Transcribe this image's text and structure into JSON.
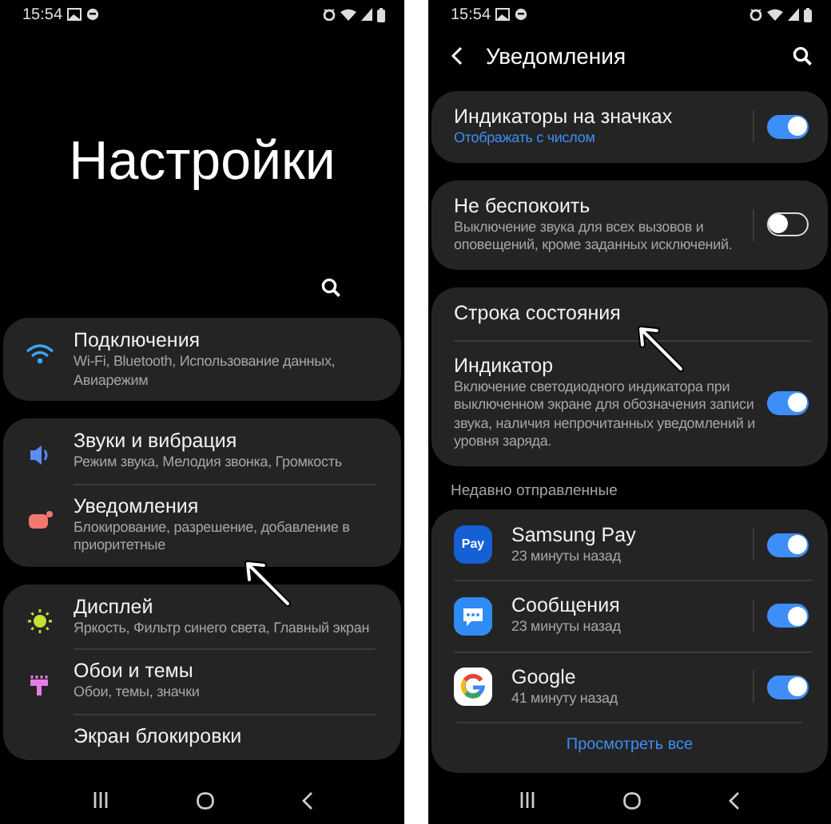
{
  "left_screen": {
    "status_bar": {
      "time": "15:54"
    },
    "title": "Настройки",
    "groups": [
      {
        "items": [
          {
            "title": "Подключения",
            "subtitle": "Wi-Fi, Bluetooth, Использование данных, Авиарежим"
          }
        ]
      },
      {
        "items": [
          {
            "title": "Звуки и вибрация",
            "subtitle": "Режим звука, Мелодия звонка, Громкость"
          },
          {
            "title": "Уведомления",
            "subtitle": "Блокирование, разрешение, добавление в приоритетные"
          }
        ]
      },
      {
        "items": [
          {
            "title": "Дисплей",
            "subtitle": "Яркость, Фильтр синего света, Главный экран"
          },
          {
            "title": "Обои и темы",
            "subtitle": "Обои, темы, значки"
          },
          {
            "title": "Экран блокировки"
          }
        ]
      }
    ]
  },
  "right_screen": {
    "status_bar": {
      "time": "15:54"
    },
    "header": {
      "title": "Уведомления"
    },
    "cards": [
      {
        "items": [
          {
            "title": "Индикаторы на значках",
            "subtitle": "Отображать с числом",
            "subtitle_accent": true,
            "on": true
          }
        ]
      },
      {
        "items": [
          {
            "title": "Не беспокоить",
            "subtitle": "Выключение звука для всех вызовов и оповещений, кроме заданных исключений.",
            "subtitle_accent": false,
            "on": false
          }
        ]
      },
      {
        "items": [
          {
            "title": "Строка состояния"
          },
          {
            "title": "Индикатор",
            "subtitle": "Включение светодиодного индикатора при выключенном экране для обозначения записи звука, наличия непрочитанных уведомлений и уровня заряда.",
            "subtitle_accent": false,
            "on": true
          }
        ]
      }
    ],
    "section_label": "Недавно отправленные",
    "apps": [
      {
        "icon_text": "Pay",
        "name": "Samsung Pay",
        "time": "23 минуты назад",
        "on": true
      },
      {
        "name": "Сообщения",
        "time": "23 минуты назад",
        "on": true
      },
      {
        "name": "Google",
        "time": "41 минуту назад",
        "on": true
      }
    ],
    "view_all": "Просмотреть все"
  }
}
